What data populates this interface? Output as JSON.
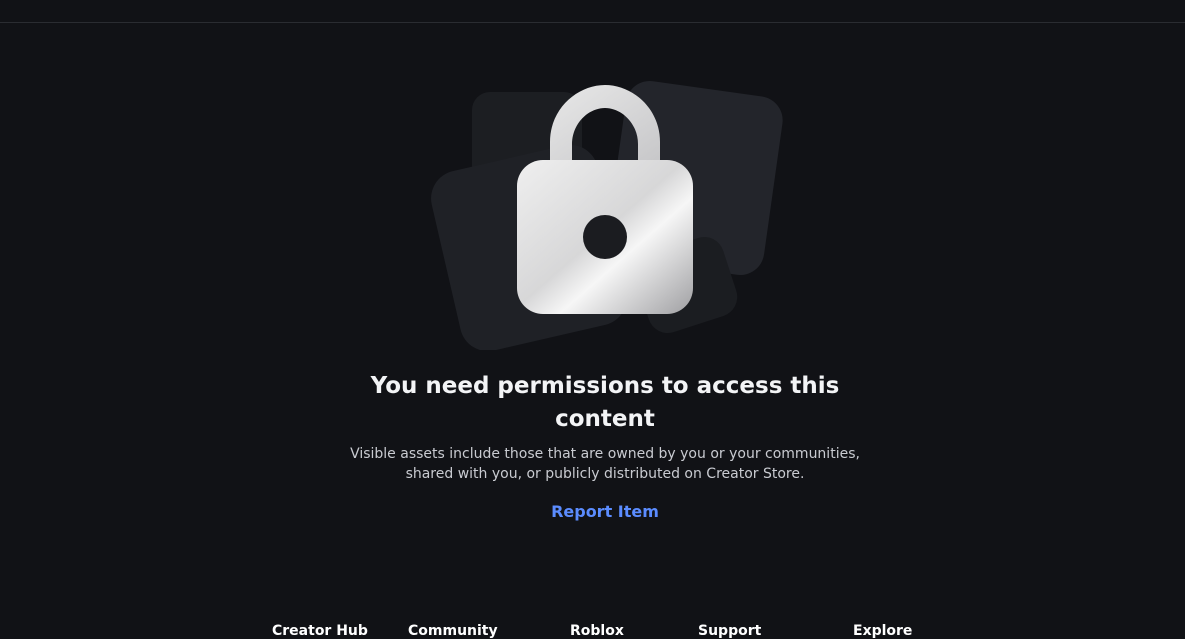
{
  "content": {
    "title": "You need permissions to access this content",
    "description": "Visible assets include those that are owned by you or your communities, shared with you, or publicly distributed on Creator Store.",
    "report_label": "Report Item"
  },
  "illustration": {
    "icon": "lock-icon",
    "colors": {
      "card_back": "#1f2126",
      "card_front": "#23252b",
      "lock_light": "#eaeaea",
      "lock_dark": "#a7a7a9"
    }
  },
  "footer": {
    "items": [
      {
        "label": "Creator Hub"
      },
      {
        "label": "Community"
      },
      {
        "label": "Roblox"
      },
      {
        "label": "Support"
      },
      {
        "label": "Explore"
      }
    ]
  },
  "theme": {
    "background": "#111216",
    "link_color": "#5b8cff",
    "text_primary": "#f3f4f6",
    "text_secondary": "#c9cbd1"
  }
}
